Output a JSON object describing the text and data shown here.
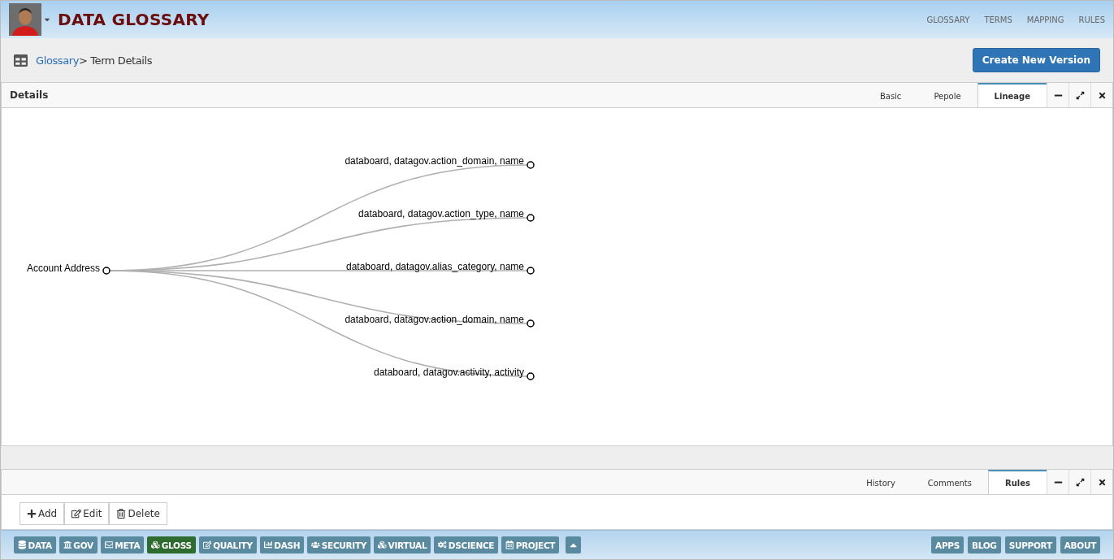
{
  "header": {
    "title": "DATA GLOSSARY",
    "nav": [
      "GLOSSARY",
      "TERMS",
      "MAPPING",
      "RULES"
    ]
  },
  "breadcrumb": {
    "link": "Glossary",
    "current": "> Term Details"
  },
  "primary_action": "Create New Version",
  "details_panel": {
    "title": "Details",
    "tabs": [
      {
        "label": "Basic",
        "selected": false
      },
      {
        "label": "Pepole",
        "selected": false
      },
      {
        "label": "Lineage",
        "selected": true
      }
    ]
  },
  "lineage": {
    "root": "Account Address",
    "targets": [
      "databoard, datagov.action_domain, name",
      "databoard, datagov.action_type, name",
      "databoard, datagov.alias_category, name",
      "databoard, datagov.action_domain, name",
      "databoard, datagov.activity, activity"
    ]
  },
  "rules_panel": {
    "tabs": [
      {
        "label": "History",
        "selected": false
      },
      {
        "label": "Comments",
        "selected": false
      },
      {
        "label": "Rules",
        "selected": true
      }
    ],
    "toolbar": [
      "Add",
      "Edit",
      "Delete"
    ]
  },
  "footer": {
    "modules": [
      {
        "label": "DATA",
        "selected": false
      },
      {
        "label": "GOV",
        "selected": false
      },
      {
        "label": "META",
        "selected": false
      },
      {
        "label": "GLOSS",
        "selected": true
      },
      {
        "label": "QUALITY",
        "selected": false
      },
      {
        "label": "DASH",
        "selected": false
      },
      {
        "label": "SECURITY",
        "selected": false
      },
      {
        "label": "VIRTUAL",
        "selected": false
      },
      {
        "label": "DSCIENCE",
        "selected": false
      },
      {
        "label": "PROJECT",
        "selected": false
      }
    ],
    "links": [
      "APPS",
      "BLOG",
      "SUPPORT",
      "ABOUT"
    ]
  }
}
